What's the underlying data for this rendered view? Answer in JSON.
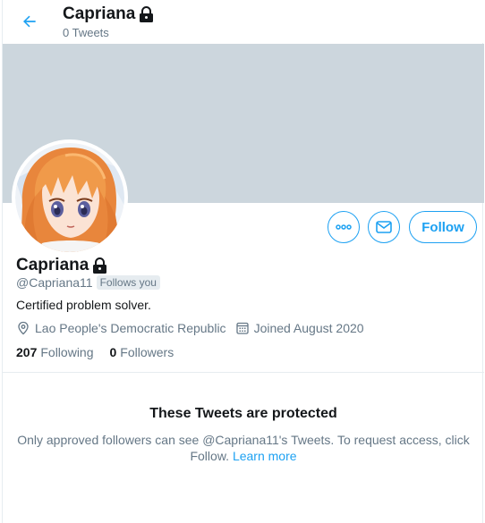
{
  "header": {
    "name": "Capriana",
    "tweet_count": "0 Tweets"
  },
  "profile": {
    "name": "Capriana",
    "handle": "@Capriana11",
    "follows_you": "Follows you",
    "bio": "Certified problem solver.",
    "location": "Lao People's Democratic Republic",
    "joined": "Joined August 2020",
    "following_count": "207",
    "following_label": "Following",
    "followers_count": "0",
    "followers_label": "Followers"
  },
  "actions": {
    "follow_label": "Follow"
  },
  "protected": {
    "title": "These Tweets are protected",
    "body": "Only approved followers can see @Capriana11's Tweets. To request access, click Follow.",
    "learn_more": "Learn more"
  },
  "colors": {
    "accent": "#1da1f2",
    "banner": "#ccd6dd",
    "secondary_text": "#657786"
  },
  "icons": [
    "back-arrow-icon",
    "lock-icon",
    "more-icon",
    "mail-icon",
    "location-icon",
    "calendar-icon"
  ]
}
